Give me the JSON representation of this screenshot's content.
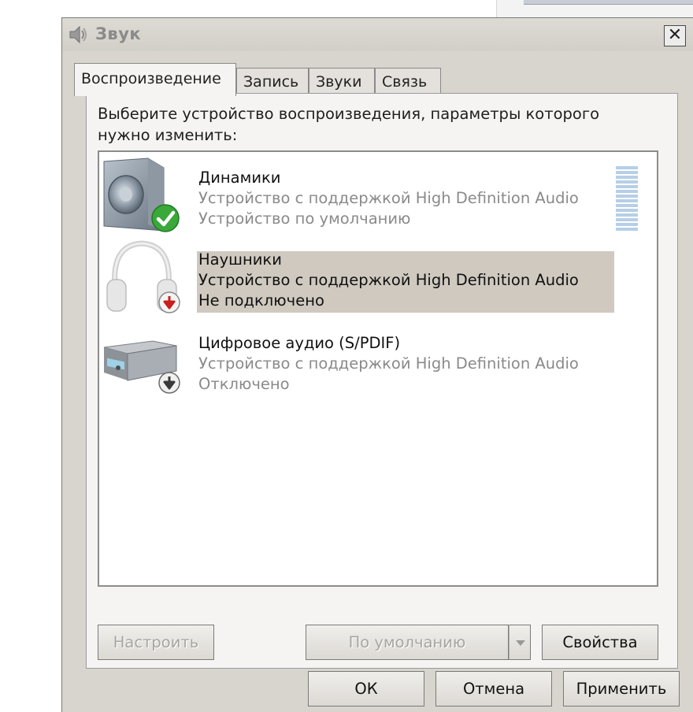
{
  "window": {
    "title": "Звук",
    "close_glyph": "✕"
  },
  "tabs": [
    {
      "label": "Воспроизведение",
      "active": true
    },
    {
      "label": "Запись",
      "active": false
    },
    {
      "label": "Звуки",
      "active": false
    },
    {
      "label": "Связь",
      "active": false
    }
  ],
  "instruction": "Выберите устройство воспроизведения, параметры которого нужно изменить:",
  "devices": [
    {
      "name": "Динамики",
      "description": "Устройство с поддержкой High Definition Audio",
      "status": "Устройство по умолчанию",
      "icon": "speaker-icon",
      "badge": "default-check-icon",
      "selected": false
    },
    {
      "name": "Наушники",
      "description": "Устройство с поддержкой High Definition Audio",
      "status": "Не подключено",
      "icon": "headphones-icon",
      "badge": "not-connected-arrow-icon",
      "selected": true
    },
    {
      "name": "Цифровое аудио (S/PDIF)",
      "description": "Устройство с поддержкой High Definition Audio",
      "status": "Отключено",
      "icon": "digital-audio-receiver-icon",
      "badge": "disabled-arrow-icon",
      "selected": false
    }
  ],
  "buttons": {
    "configure": "Настроить",
    "set_default": "По умолчанию",
    "properties": "Свойства",
    "ok": "ОК",
    "cancel": "Отмена",
    "apply": "Применить"
  },
  "colors": {
    "window_bg": "#d8d4ce",
    "selection": "#cfc9c0",
    "check_green": "#3aa83a",
    "arrow_red": "#c8201c"
  }
}
